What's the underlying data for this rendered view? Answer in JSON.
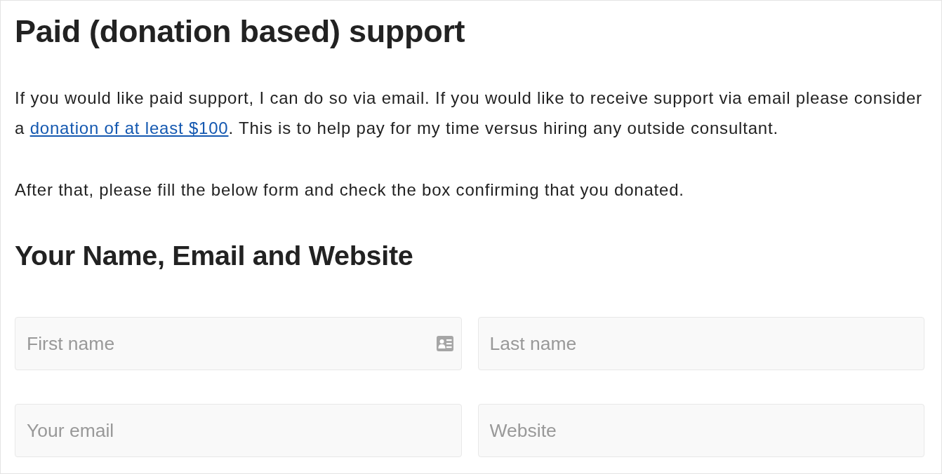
{
  "heading": "Paid (donation based) support",
  "intro": {
    "before": "If you would like paid support, I can do so via email. If you would like to receive support via email please consider a ",
    "link": "donation of at least $100",
    "after": ". This is to help pay for my time versus hiring any outside consultant."
  },
  "instruction": "After that, please fill the below form and check the box confirming that you donated.",
  "form_title": "Your Name, Email and Website",
  "fields": [
    {
      "placeholder": "First name",
      "autofill_icon": true
    },
    {
      "placeholder": "Last name",
      "autofill_icon": false
    },
    {
      "placeholder": "Your email",
      "autofill_icon": false
    },
    {
      "placeholder": "Website",
      "autofill_icon": false
    }
  ]
}
